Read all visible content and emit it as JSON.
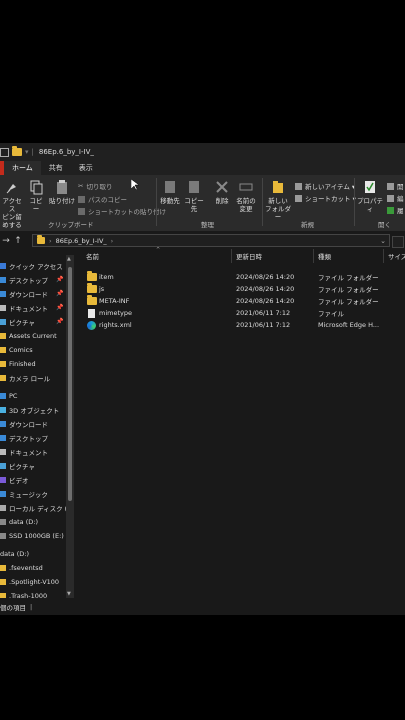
{
  "window": {
    "path_label": "86Ep.6_by_I-IV_"
  },
  "ribbon_tabs": [
    {
      "label": "ホーム"
    },
    {
      "label": "共有"
    },
    {
      "label": "表示"
    }
  ],
  "ribbon": {
    "pin_access_label_1": "アクセス",
    "pin_access_label_2": "ピン留めする",
    "copy": "コピー",
    "paste": "貼り付け",
    "cut": "切り取り",
    "copy_path": "パスのコピー",
    "paste_shortcut": "ショートカットの貼り付け",
    "group_clipboard": "クリップボード",
    "move_to": "移動先",
    "copy_to": "コピー先",
    "delete": "削除",
    "rename_1": "名前の",
    "rename_2": "変更",
    "group_organize": "整理",
    "new_folder_1": "新しい",
    "new_folder_2": "フォルダー",
    "new_item": "新しいアイテム ▾",
    "shortcut": "ショートカット ▾",
    "group_new": "新規",
    "properties": "プロパティ",
    "group_open": "開く",
    "open_partial": "開",
    "edit_partial": "編",
    "history_partial": "履"
  },
  "address": {
    "crumb": "86Ep.6_by_I-IV_"
  },
  "nav_pane": {
    "quick_access": "クイック アクセス",
    "quick_items": [
      "デスクトップ",
      "ダウンロード",
      "ドキュメント",
      "ピクチャ",
      "Assets Current",
      "Comics",
      "Finished",
      "カメラ ロール"
    ],
    "pc": "PC",
    "pc_items": [
      "3D オブジェクト",
      "ダウンロード",
      "デスクトップ",
      "ドキュメント",
      "ピクチャ",
      "ビデオ",
      "ミュージック",
      "ローカル ディスク (C:)",
      "data (D:)",
      "SSD 1000GB (E:)"
    ],
    "drive": "data (D:)",
    "drive_items": [
      ".fseventsd",
      ".Spotlight-V100",
      ".Trash-1000"
    ]
  },
  "columns": {
    "name": "名前",
    "modified": "更新日時",
    "type": "種類",
    "size": "サイズ"
  },
  "files": [
    {
      "name": "item",
      "modified": "2024/08/26 14:20",
      "type": "ファイル フォルダー",
      "icon": "folder"
    },
    {
      "name": "js",
      "modified": "2024/08/26 14:20",
      "type": "ファイル フォルダー",
      "icon": "folder"
    },
    {
      "name": "META-INF",
      "modified": "2024/08/26 14:20",
      "type": "ファイル フォルダー",
      "icon": "folder"
    },
    {
      "name": "mimetype",
      "modified": "2021/06/11 7:12",
      "type": "ファイル",
      "icon": "file"
    },
    {
      "name": "rights.xml",
      "modified": "2021/06/11 7:12",
      "type": "Microsoft Edge H...",
      "icon": "edge"
    }
  ],
  "status": {
    "count": "個の項目"
  },
  "colors": {
    "folder": "#e8b93a",
    "file_tab": "#c42b1c",
    "background": "#191919",
    "ribbon": "#2b2b2b"
  }
}
